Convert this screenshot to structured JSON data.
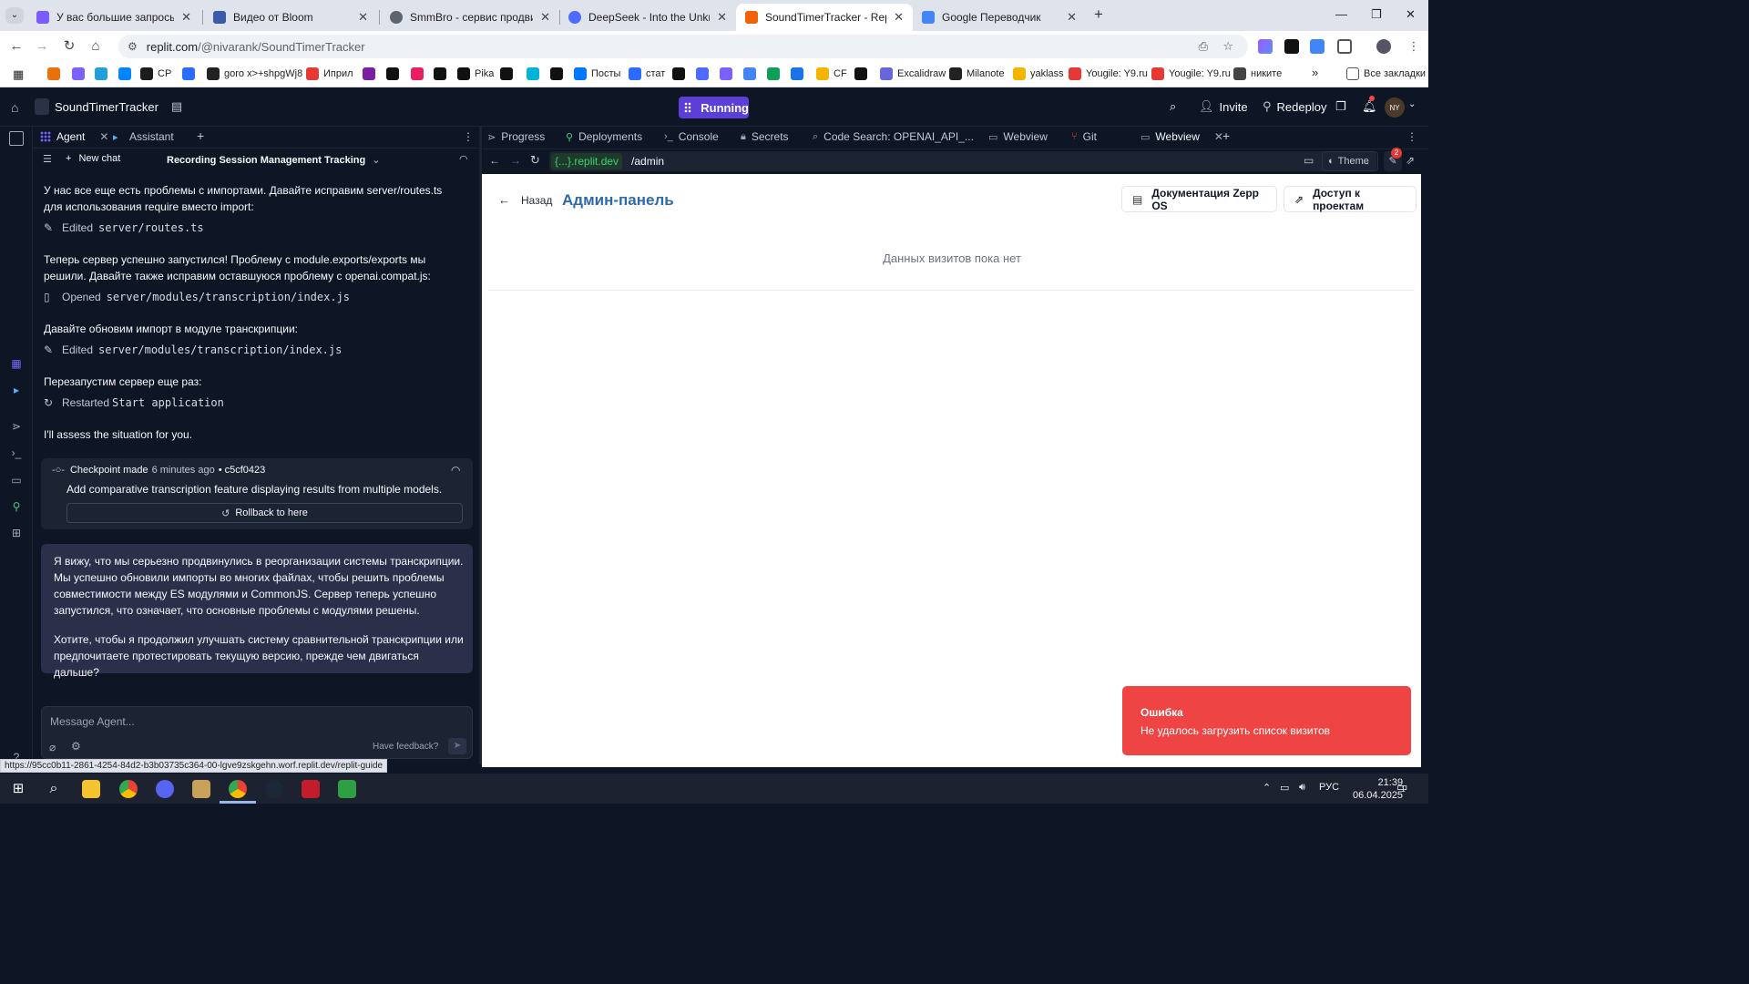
{
  "browser": {
    "tabs": [
      {
        "title": "У вас большие запросы!",
        "color": "#7a5cff",
        "close": "✕"
      },
      {
        "title": "Видео от Bloom",
        "color": "#3b5aa8",
        "close": "✕"
      },
      {
        "title": "SmmBro - сервис продвижен",
        "color": "#5c6470",
        "close": "✕"
      },
      {
        "title": "DeepSeek - Into the Unknown",
        "color": "#4d6bfe",
        "close": "✕"
      },
      {
        "title": "SoundTimerTracker - Replit",
        "color": "#f26207",
        "close": "✕"
      },
      {
        "title": "Google Переводчик",
        "color": "#4285f4",
        "close": "✕"
      }
    ],
    "url_domain": "replit.com",
    "url_path": "/@nivarank/SoundTimerTracker",
    "bookmarks": [
      {
        "label": "",
        "color": "#e8710a"
      },
      {
        "label": "",
        "color": "#7b61ff"
      },
      {
        "label": "",
        "color": "#229ed9"
      },
      {
        "label": "",
        "color": "#0084ff"
      },
      {
        "label": "CP",
        "color": "#1c1c1c"
      },
      {
        "label": "",
        "color": "#2b6bff"
      },
      {
        "label": "goro x>+shpgWj8",
        "color": "#222"
      },
      {
        "label": "Иприл",
        "color": "#e53935"
      },
      {
        "label": "",
        "color": "#7b1fa2"
      },
      {
        "label": "",
        "color": "#111"
      },
      {
        "label": "",
        "color": "#e91e63"
      },
      {
        "label": "",
        "color": "#111"
      },
      {
        "label": "Pika",
        "color": "#111"
      },
      {
        "label": "",
        "color": "#111"
      },
      {
        "label": "",
        "color": "#00b4d8"
      },
      {
        "label": "",
        "color": "#111"
      },
      {
        "label": "Посты",
        "color": "#0077ff"
      },
      {
        "label": "стат",
        "color": "#2b6bff"
      },
      {
        "label": "",
        "color": "#111"
      },
      {
        "label": "",
        "color": "#4d6bfe"
      },
      {
        "label": "",
        "color": "#7b61ff"
      },
      {
        "label": "",
        "color": "#4285f4"
      },
      {
        "label": "",
        "color": "#0f9d58"
      },
      {
        "label": "",
        "color": "#1a73e8"
      },
      {
        "label": "CF",
        "color": "#f4b400"
      },
      {
        "label": "",
        "color": "#111"
      },
      {
        "label": "Excalidraw",
        "color": "#6965db"
      },
      {
        "label": "Milanote",
        "color": "#222"
      },
      {
        "label": "yaklass",
        "color": "#f4b400"
      },
      {
        "label": "Yougile: Y9.ru",
        "color": "#e53935"
      },
      {
        "label": "Yougile: Y9.ru",
        "color": "#e53935"
      },
      {
        "label": "никите",
        "color": "#444"
      }
    ],
    "all_bookmarks": "Все закладки",
    "more_bookmarks": "»"
  },
  "header": {
    "project_name": "SoundTimerTracker",
    "run_label": "Running",
    "search": "⌕",
    "invite": "Invite",
    "redeploy": "Redeploy",
    "avatar": "NY"
  },
  "agent": {
    "tabs": [
      "Agent",
      "Assistant"
    ],
    "new_chat": "New chat",
    "chat_title": "Recording Session Management Tracking",
    "messages": {
      "m1": "У нас все еще есть проблемы с импортами. Давайте исправим server/routes.ts для использования require вместо import:",
      "a1_verb": "Edited",
      "a1_file": "server/routes.ts",
      "m2": "Теперь сервер успешно запустился! Проблему с module.exports/exports мы решили. Давайте также исправим оставшуюся проблему с openai.compat.js:",
      "a2_verb": "Opened",
      "a2_file": "server/modules/transcription/index.js",
      "m3": "Давайте обновим импорт в модуле транскрипции:",
      "a3_verb": "Edited",
      "a3_file": "server/modules/transcription/index.js",
      "m4": "Перезапустим сервер еще раз:",
      "a4_verb": "Restarted",
      "a4_file": "Start application",
      "m5": "I'll assess the situation for you."
    },
    "checkpoint": {
      "label": "Checkpoint made",
      "time": "6 minutes ago",
      "hash": "• c5cf0423",
      "summary": "Add comparative transcription feature displaying results from multiple models.",
      "rollback": "Rollback to here"
    },
    "ai_reply": {
      "p1": "Я вижу, что мы серьезно продвинулись в реорганизации системы транскрипции. Мы успешно обновили импорты во многих файлах, чтобы решить проблемы совместимости между ES модулями и CommonJS. Сервер теперь успешно запустился, что означает, что основные проблемы с модулями решены.",
      "p2": "Хотите, чтобы я продолжил улучшать систему сравнительной транскрипции или предпочитаете протестировать текущую версию, прежде чем двигаться дальше?"
    },
    "input_placeholder": "Message Agent...",
    "feedback": "Have feedback?"
  },
  "ide": {
    "tabs": [
      "Progress",
      "Deployments",
      "Console",
      "Secrets",
      "Code Search: OPENAI_API_...",
      "Webview",
      "Git",
      "Webview"
    ],
    "webview_domain": "{...}.replit.dev",
    "webview_path": "/admin",
    "theme": "Theme",
    "badge": "2"
  },
  "page": {
    "back": "Назад",
    "title": "Админ-панель",
    "docs_button": "Документация Zepp OS",
    "access_button": "Доступ к проектам",
    "empty": "Данных визитов пока нет",
    "toast_title": "Ошибка",
    "toast_message": "Не удалось загрузить список визитов"
  },
  "status_url": "https://95cc0b11-2861-4254-84d2-b3b03735c364-00-lgve9zskgehn.worf.replit.dev/replit-guide",
  "taskbar": {
    "lang": "РУС",
    "time": "21:39",
    "date": "06.04.2025",
    "notif": "1"
  }
}
